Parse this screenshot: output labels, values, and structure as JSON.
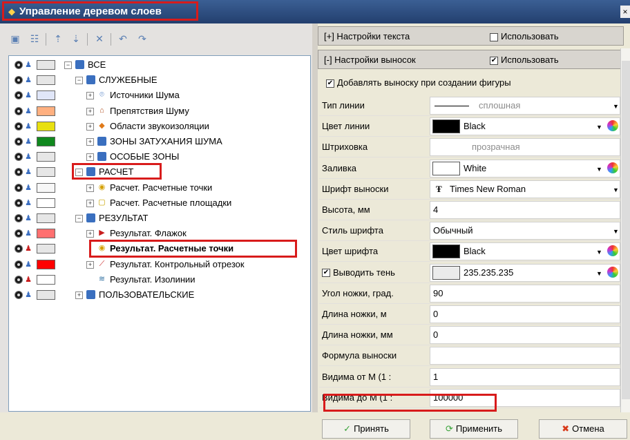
{
  "window": {
    "title": "Управление деревом слоев",
    "close_symbol": "×"
  },
  "toolbar": {
    "icons": [
      "add-layer-icon",
      "properties-icon",
      "move-up-icon",
      "move-down-icon",
      "delete-icon",
      "undo-icon",
      "redo-icon"
    ]
  },
  "tree": {
    "rows": [
      {
        "label": "ВСЕ",
        "swatch": "#e6e6e6",
        "expander": "−",
        "icon": "folder",
        "lock_red": false,
        "bold": false
      },
      {
        "label": "СЛУЖЕБНЫЕ",
        "swatch": "#e6e6e6",
        "expander": "−",
        "icon": "folder",
        "lock_red": false,
        "bold": false
      },
      {
        "label": "Источники Шума",
        "swatch": "#e0e6f8",
        "expander": "+",
        "icon": "noise-source",
        "lock_red": false,
        "bold": false
      },
      {
        "label": "Препятствия Шуму",
        "swatch": "#ffb080",
        "expander": "+",
        "icon": "obstacle",
        "lock_red": false,
        "bold": false
      },
      {
        "label": "Области звукоизоляции",
        "swatch": "#e8e010",
        "expander": "+",
        "icon": "area",
        "lock_red": false,
        "bold": false
      },
      {
        "label": "ЗОНЫ ЗАТУХАНИЯ ШУМА",
        "swatch": "#10881e",
        "expander": "+",
        "icon": "folder",
        "lock_red": false,
        "bold": false
      },
      {
        "label": "ОСОБЫЕ ЗОНЫ",
        "swatch": "#e6e6e6",
        "expander": "+",
        "icon": "folder",
        "lock_red": false,
        "bold": false
      },
      {
        "label": "РАСЧЕТ",
        "swatch": "#e6e6e6",
        "expander": "−",
        "icon": "folder",
        "lock_red": false,
        "bold": false
      },
      {
        "label": "Расчет. Расчетные точки",
        "swatch": "#f7f7f7",
        "expander": "+",
        "icon": "calc-point",
        "lock_red": false,
        "bold": false
      },
      {
        "label": "Расчет. Расчетные площадки",
        "swatch": "#ffffff",
        "expander": "+",
        "icon": "calc-area",
        "lock_red": false,
        "bold": false
      },
      {
        "label": "РЕЗУЛЬТАТ",
        "swatch": "#e6e6e6",
        "expander": "−",
        "icon": "folder",
        "lock_red": false,
        "bold": false
      },
      {
        "label": "Результат. Флажок",
        "swatch": "#ff7070",
        "expander": "+",
        "icon": "flag",
        "lock_red": false,
        "bold": false
      },
      {
        "label": "Результат. Расчетные точки",
        "swatch": "#e6e6e6",
        "expander": "",
        "icon": "calc-point",
        "lock_red": true,
        "bold": true
      },
      {
        "label": "Результат. Контрольный отрезок",
        "swatch": "#ff0000",
        "expander": "+",
        "icon": "segment",
        "lock_red": false,
        "bold": false
      },
      {
        "label": "Результат. Изолинии",
        "swatch": "#ffffff",
        "expander": "",
        "icon": "isolines",
        "lock_red": true,
        "bold": false
      },
      {
        "label": "ПОЛЬЗОВАТЕЛЬСКИЕ",
        "swatch": "#e6e6e6",
        "expander": "+",
        "icon": "folder",
        "lock_red": false,
        "bold": false
      }
    ]
  },
  "sections": {
    "text": {
      "label": "[+] Настройки текста",
      "use_label": "Использовать",
      "checked": false
    },
    "callout": {
      "label": "[-] Настройки выносок",
      "use_label": "Использовать",
      "checked": true
    }
  },
  "callout": {
    "add_on_create": {
      "label": "Добавлять выноску при создании фигуры",
      "checked": true
    },
    "properties": [
      {
        "label": "Тип линии",
        "value": "сплошная",
        "kind": "line"
      },
      {
        "label": "Цвет линии",
        "value": "Black",
        "kind": "color",
        "color": "#000000"
      },
      {
        "label": "Штриховка",
        "value": "прозрачная",
        "kind": "disabled"
      },
      {
        "label": "Заливка",
        "value": "White",
        "kind": "color",
        "color": "#ffffff"
      },
      {
        "label": "Шрифт выноски",
        "value": "Times New Roman",
        "kind": "font"
      },
      {
        "label": "Высота, мм",
        "value": "4",
        "kind": "text"
      },
      {
        "label": "Стиль шрифта",
        "value": "Обычный",
        "kind": "dropdown"
      },
      {
        "label": "Цвет шрифта",
        "value": "Black",
        "kind": "color",
        "color": "#000000"
      },
      {
        "label": "Выводить тень",
        "value": "235.235.235",
        "kind": "shadow",
        "color": "#ebebeb",
        "checked": true
      },
      {
        "label": "Угол ножки, град.",
        "value": "90",
        "kind": "text"
      },
      {
        "label": "Длина ножки, м",
        "value": "0",
        "kind": "text"
      },
      {
        "label": "Длина ножки, мм",
        "value": "0",
        "kind": "text"
      },
      {
        "label": "Формула выноски",
        "value": "",
        "kind": "text"
      },
      {
        "label": "Видима от М (1 :",
        "value": "1",
        "kind": "text"
      },
      {
        "label": "Видима до М (1 :",
        "value": "100000",
        "kind": "text"
      }
    ]
  },
  "buttons": {
    "accept": "Принять",
    "apply": "Применить",
    "cancel": "Отмена"
  },
  "colors": {
    "highlight": "#d81b1b",
    "title_bar": "#2d4b7d"
  }
}
